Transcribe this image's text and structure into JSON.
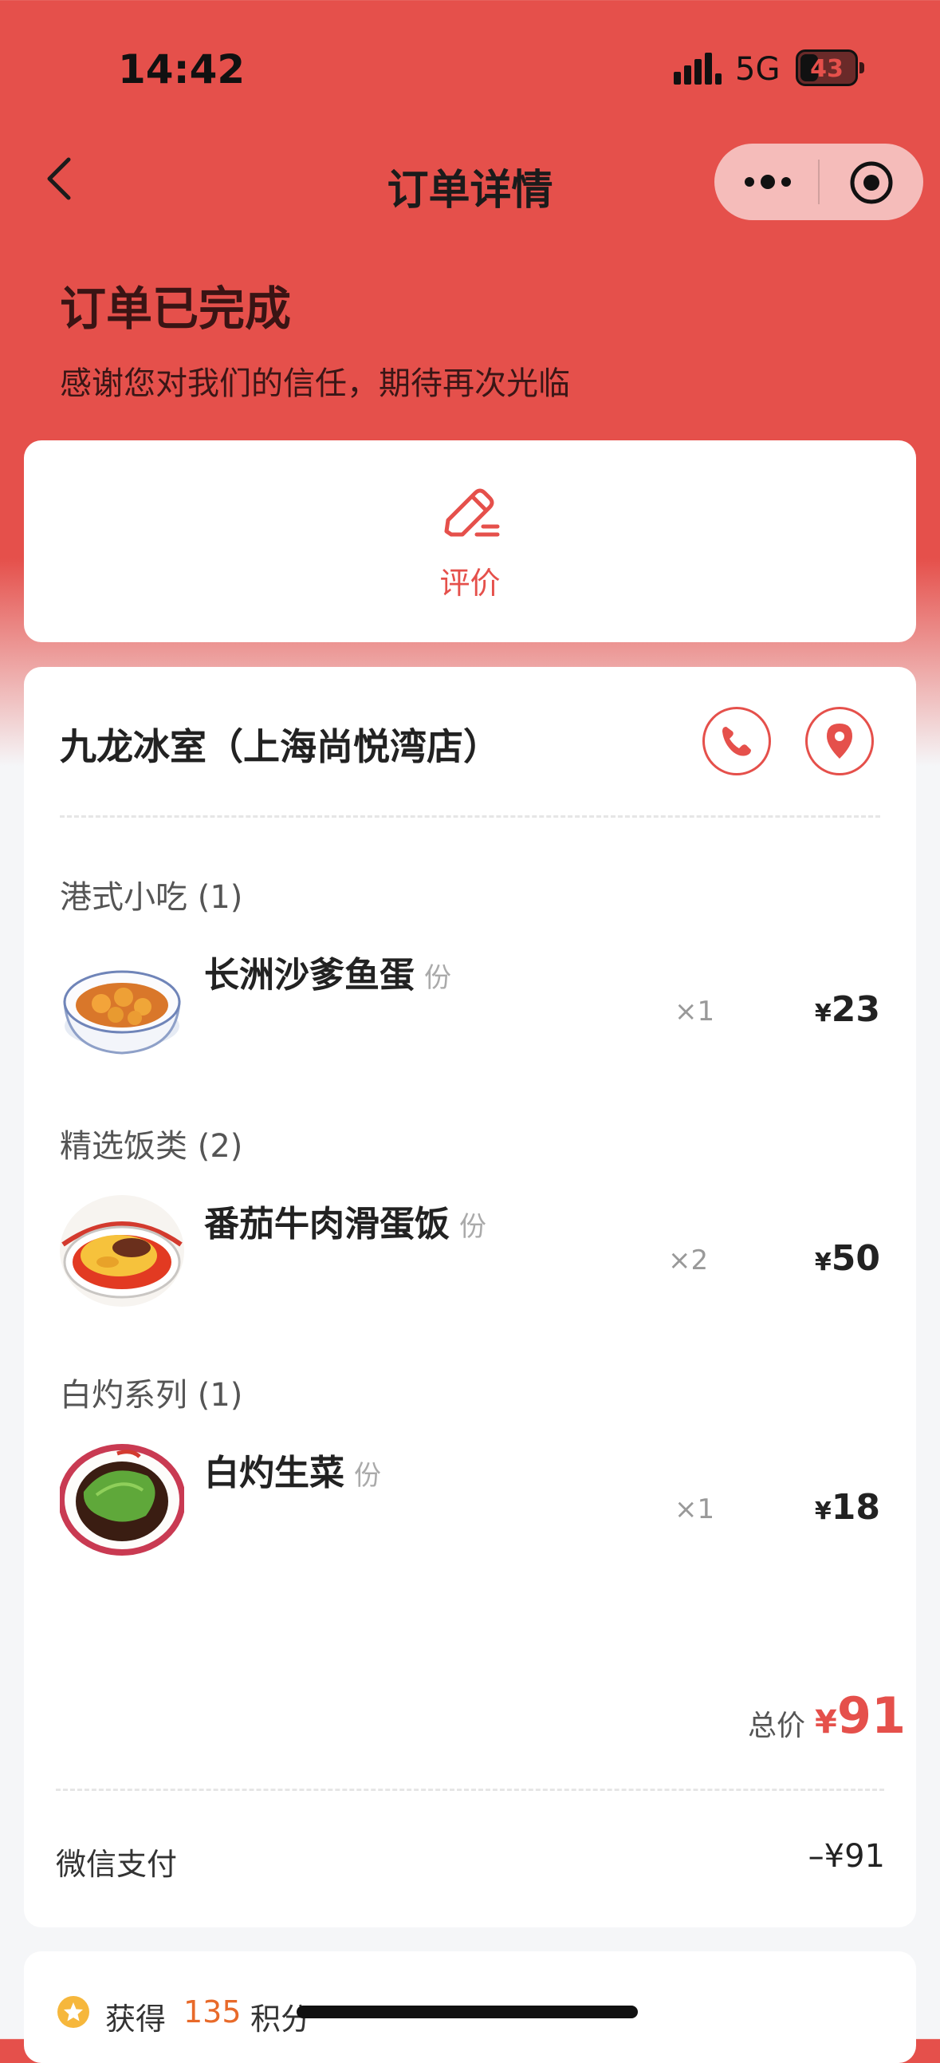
{
  "status_bar": {
    "time": "14:42",
    "network": "5G",
    "battery": "43"
  },
  "nav": {
    "title": "订单详情"
  },
  "order_status": {
    "title": "订单已完成",
    "subtitle": "感谢您对我们的信任，期待再次光临"
  },
  "review": {
    "label": "评价"
  },
  "store": {
    "name": "九龙冰室（上海尚悦湾店）"
  },
  "categories": [
    {
      "title": "港式小吃 (1)",
      "item": {
        "name": "长洲沙爹鱼蛋",
        "unit": "份",
        "qty": "×1",
        "yen": "¥",
        "price": "23"
      }
    },
    {
      "title": "精选饭类 (2)",
      "item": {
        "name": "番茄牛肉滑蛋饭",
        "unit": "份",
        "qty": "×2",
        "yen": "¥",
        "price": "50"
      }
    },
    {
      "title": "白灼系列 (1)",
      "item": {
        "name": "白灼生菜",
        "unit": "份",
        "qty": "×1",
        "yen": "¥",
        "price": "18"
      }
    }
  ],
  "total": {
    "label": "总价",
    "yen": "¥",
    "amount": "91"
  },
  "payment": {
    "method": "微信支付",
    "amount": "–¥91"
  },
  "points": {
    "prefix": "获得",
    "value": "135",
    "suffix": "积分"
  },
  "colors": {
    "accent": "#e5504b",
    "points": "#e86a2a"
  }
}
